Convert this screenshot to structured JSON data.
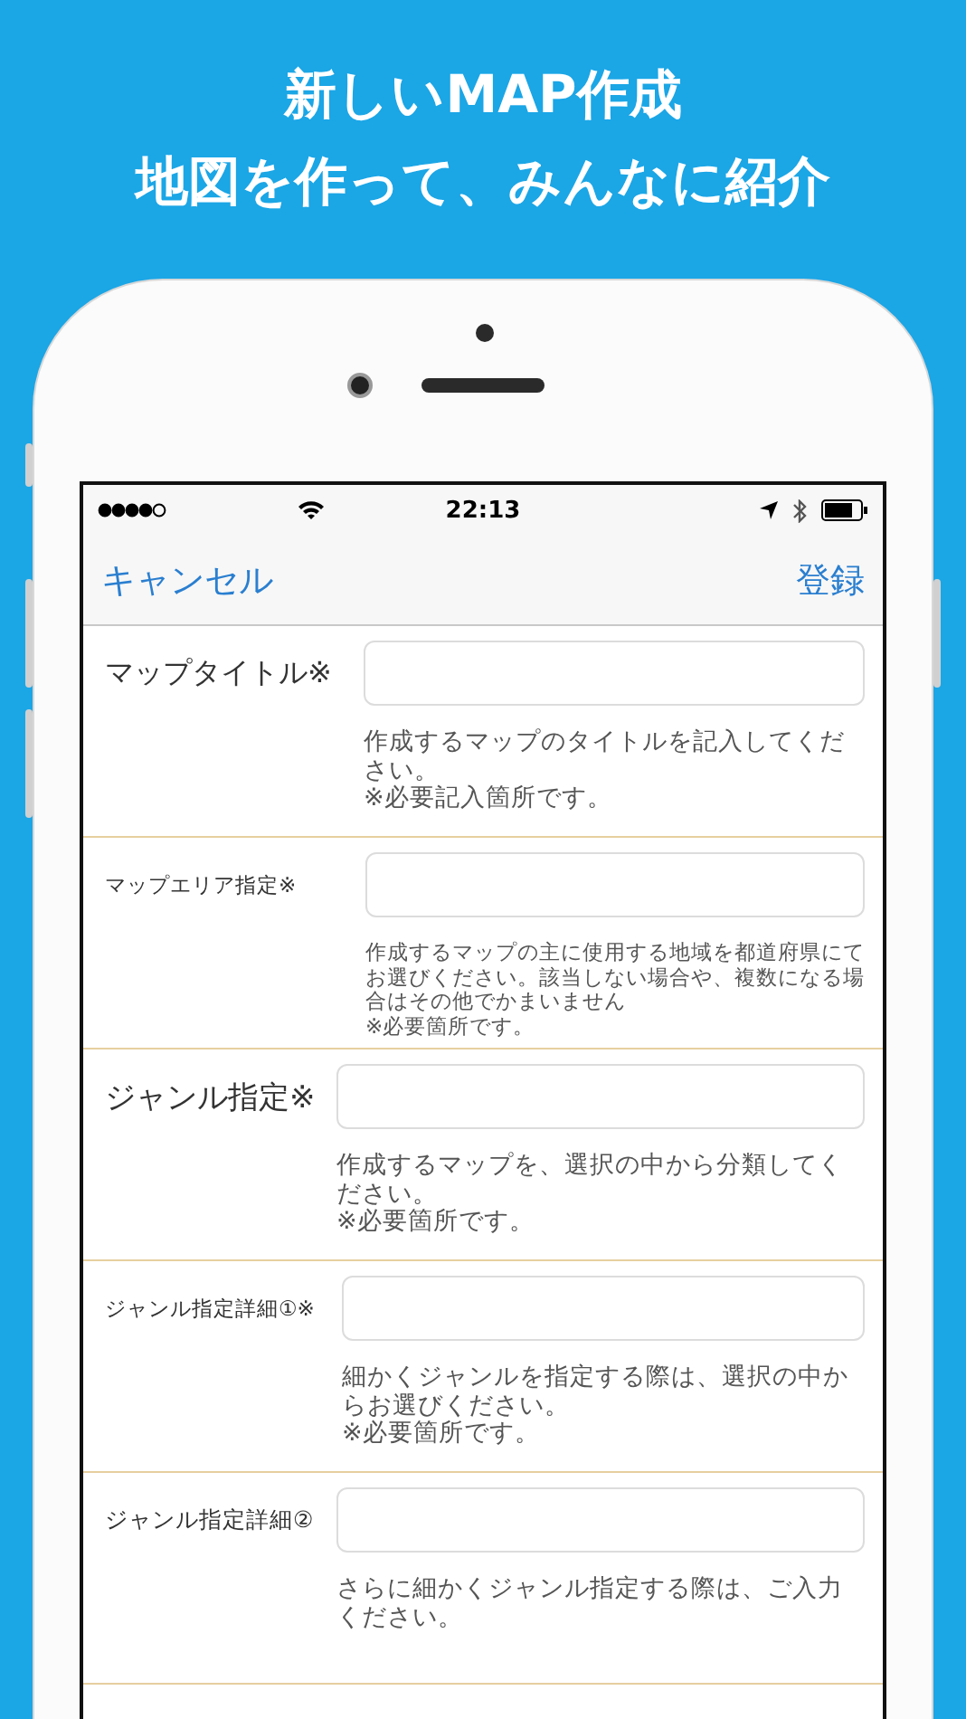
{
  "headline": [
    "新しいMAP作成",
    "地図を作って、みんなに紹介"
  ],
  "status_bar": {
    "time": "22:13"
  },
  "nav": {
    "cancel": "キャンセル",
    "register": "登録"
  },
  "rows": [
    {
      "label": "マップタイトル※",
      "hint": [
        "作成するマップのタイトルを記入してください。",
        "※必要記入箇所です。"
      ]
    },
    {
      "label": "マップエリア指定※",
      "hint": [
        "作成するマップの主に使用する地域を都道府県にてお選びください。該当しない場合や、複数になる場合はその他でかまいません",
        "※必要箇所です。"
      ]
    },
    {
      "label": "ジャンル指定※",
      "hint": [
        "作成するマップを、選択の中から分類してください。",
        "※必要箇所です。"
      ]
    },
    {
      "label": "ジャンル指定詳細①※",
      "hint": [
        "細かくジャンルを指定する際は、選択の中からお選びください。",
        "※必要箇所です。"
      ]
    },
    {
      "label": "ジャンル指定詳細②",
      "hint": [
        "さらに細かくジャンル指定する際は、ご入力ください。"
      ]
    }
  ]
}
